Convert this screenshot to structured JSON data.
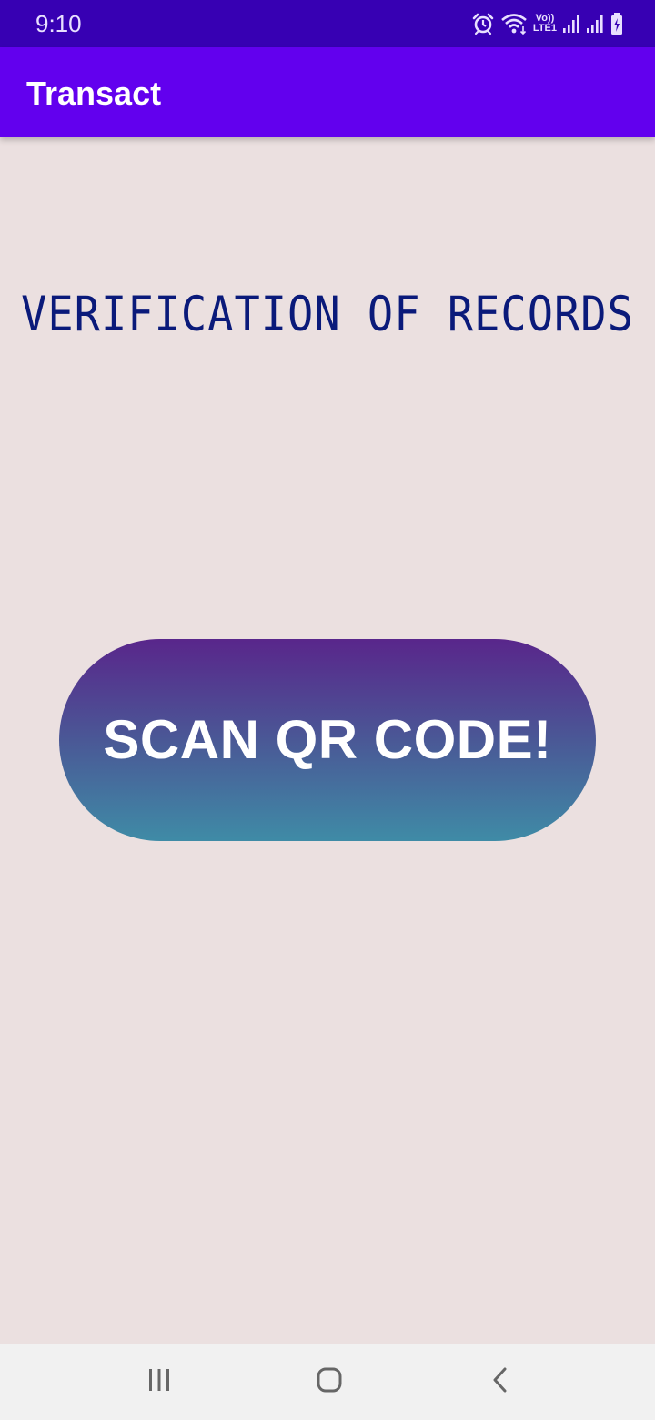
{
  "status_bar": {
    "time": "9:10",
    "icons": [
      "alarm-icon",
      "wifi-icon",
      "volte-lte1-icon",
      "signal-icon",
      "signal-icon",
      "battery-charging-icon"
    ],
    "volte_text": "Vo))",
    "lte_text": "LTE1"
  },
  "app_bar": {
    "title": "Transact",
    "color": "#6200ee"
  },
  "main": {
    "heading": "VERIFICATION OF RECORDS",
    "scan_button_label": "SCAN QR CODE!"
  },
  "nav_bar": {
    "icons": [
      "recents-icon",
      "home-icon",
      "back-icon"
    ]
  },
  "colors": {
    "status_bar": "#3700b3",
    "background": "#ebe0e0",
    "heading": "#0a1a7a",
    "button_gradient_top": "#59268b",
    "button_gradient_bottom": "#3f8ba6"
  }
}
